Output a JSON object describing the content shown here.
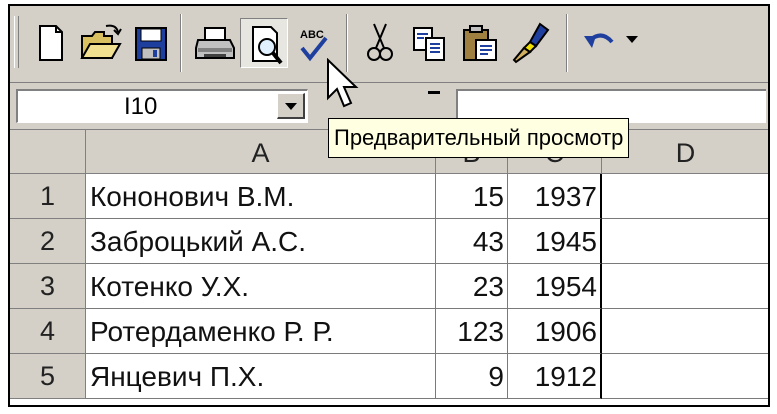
{
  "toolbar": {
    "buttons": [
      {
        "name": "new-document",
        "icon": "new-document-icon"
      },
      {
        "name": "open",
        "icon": "open-folder-icon"
      },
      {
        "name": "save",
        "icon": "floppy-disk-icon"
      },
      {
        "name": "print",
        "icon": "printer-icon"
      },
      {
        "name": "print-preview",
        "icon": "print-preview-icon"
      },
      {
        "name": "spelling",
        "icon": "spell-check-icon"
      },
      {
        "name": "cut",
        "icon": "scissors-icon"
      },
      {
        "name": "copy",
        "icon": "copy-icon"
      },
      {
        "name": "paste",
        "icon": "clipboard-icon"
      },
      {
        "name": "format-painter",
        "icon": "paintbrush-icon"
      },
      {
        "name": "undo",
        "icon": "undo-arrow-icon"
      }
    ],
    "spelling_label": "ABC"
  },
  "name_box": {
    "value": "I10"
  },
  "tooltip": {
    "text": "Предварительный просмотр"
  },
  "grid": {
    "columns": [
      "A",
      "B",
      "C",
      "D"
    ],
    "rows": [
      {
        "num": "1",
        "a": "Кононович В.М.",
        "b": "15",
        "c": "1937",
        "d": ""
      },
      {
        "num": "2",
        "a": "Заброцький А.С.",
        "b": "43",
        "c": "1945",
        "d": ""
      },
      {
        "num": "3",
        "a": "Котенко У.Х.",
        "b": "23",
        "c": "1954",
        "d": ""
      },
      {
        "num": "4",
        "a": "Ротердаменко Р. Р.",
        "b": "123",
        "c": "1906",
        "d": ""
      },
      {
        "num": "5",
        "a": "Янцевич П.Х.",
        "b": "9",
        "c": "1912",
        "d": ""
      }
    ]
  },
  "colors": {
    "face": "#d4d0c8",
    "tooltip_bg": "#ffffe1",
    "toolbar_blue": "#1f3f9f"
  }
}
